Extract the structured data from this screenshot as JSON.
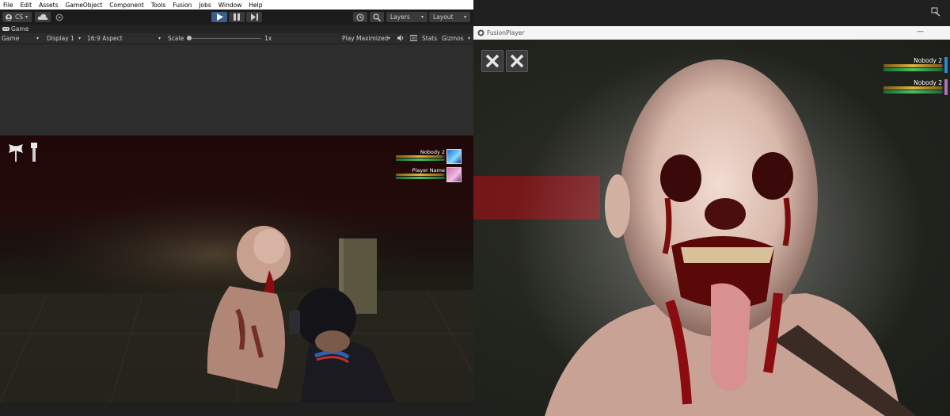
{
  "editor": {
    "menu": [
      "File",
      "Edit",
      "Assets",
      "GameObject",
      "Component",
      "Tools",
      "Fusion",
      "Jobs",
      "Window",
      "Help"
    ],
    "toolbar": {
      "account_label": "CS",
      "layers_label": "Layers",
      "layout_label": "Layout"
    },
    "game_tab_label": "Game",
    "game_toolbar": {
      "view_label": "Game",
      "display_label": "Display 1",
      "aspect_label": "16:9 Aspect",
      "scale_label": "Scale",
      "scale_value": "1x",
      "play_mode_label": "Play Maximized",
      "stats_label": "Stats",
      "gizmos_label": "Gizmos"
    },
    "hud": {
      "players": [
        {
          "name": "Nobody 2",
          "health": 0.95,
          "stamina": 0.98
        },
        {
          "name": "Player Name",
          "health": 0.97,
          "stamina": 0.98
        }
      ]
    }
  },
  "player": {
    "title": "FusionPlayer",
    "minimize_label": "—",
    "hud": {
      "players": [
        {
          "name": "Nobody 2",
          "health": 0.97,
          "stamina": 0.98
        },
        {
          "name": "Nobody 2",
          "health": 0.97,
          "stamina": 0.98
        }
      ]
    }
  },
  "colors": {
    "health_bar": "#e0b040",
    "stamina_bar": "#4cc060",
    "play_button": "#3b5f8a",
    "blood_red": "#8a0c10"
  }
}
